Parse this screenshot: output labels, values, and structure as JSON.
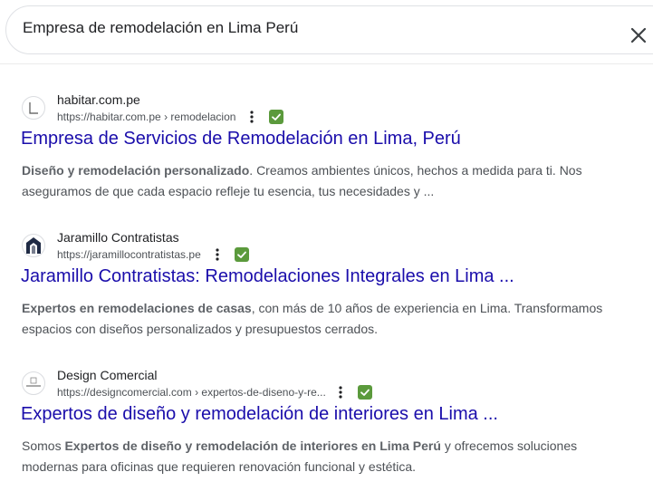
{
  "search": {
    "query": "Empresa de remodelación en Lima Perú"
  },
  "results": [
    {
      "site_name": "habitar.com.pe",
      "url": "https://habitar.com.pe › remodelacion",
      "title": "Empresa de Servicios de Remodelación en Lima, Perú",
      "snippet_bold": "Diseño y remodelación personalizado",
      "snippet_rest1": ". Creamos ambientes únicos, hechos a medida para ti. Nos aseguramos de que cada espacio refleje tu esencia, tus necesidades y ...",
      "favicon": "house-outline-icon"
    },
    {
      "site_name": "Jaramillo Contratistas",
      "url": "https://jaramillocontratistas.pe",
      "title": "Jaramillo Contratistas: Remodelaciones Integrales en Lima ...",
      "snippet_bold": "Expertos en remodelaciones de casas",
      "snippet_rest1": ", con más de 10 años de experiencia en Lima. Transformamos espacios con diseños personalizados y presupuestos cerrados.",
      "favicon": "jaramillo-logo-icon"
    },
    {
      "site_name": "Design Comercial",
      "url": "https://designcomercial.com › expertos-de-diseno-y-re...",
      "title": "Expertos de diseño y remodelación de interiores en Lima ...",
      "snippet_pre": "Somos ",
      "snippet_bold": "Expertos de diseño y remodelación de interiores en Lima Perú",
      "snippet_rest1": " y ofrecemos soluciones modernas para oficinas que requieren renovación funcional y estética.",
      "favicon": "design-comercial-logo-icon"
    }
  ],
  "colors": {
    "link": "#1a0dab",
    "verified": "#5b9a3c",
    "text": "#202124",
    "muted": "#4d5156"
  }
}
